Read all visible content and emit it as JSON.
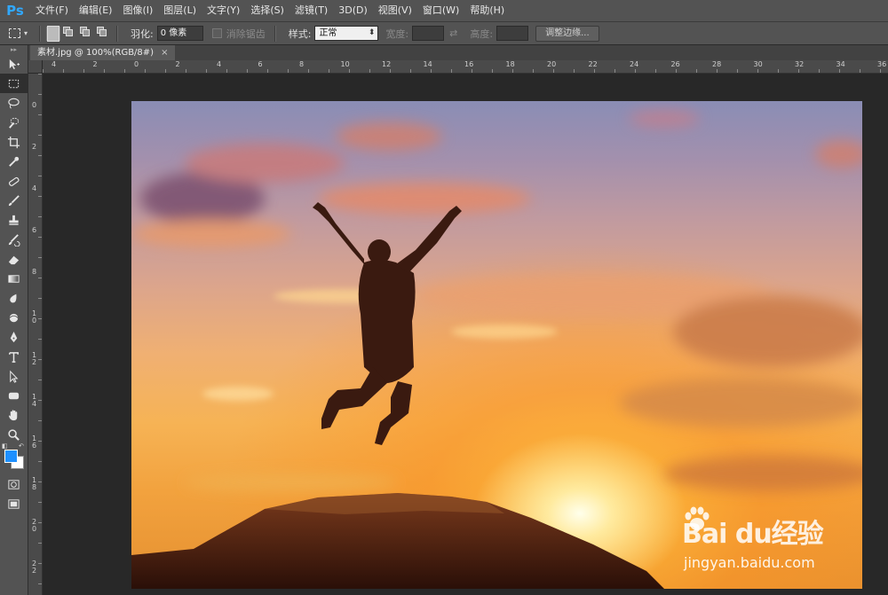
{
  "app": {
    "logo": "Ps"
  },
  "menu": [
    "文件(F)",
    "编辑(E)",
    "图像(I)",
    "图层(L)",
    "文字(Y)",
    "选择(S)",
    "滤镜(T)",
    "3D(D)",
    "视图(V)",
    "窗口(W)",
    "帮助(H)"
  ],
  "options": {
    "feather_label": "羽化:",
    "feather_value": "0 像素",
    "antialias_label": "消除锯齿",
    "style_label": "样式:",
    "style_value": "正常",
    "width_label": "宽度:",
    "height_label": "高度:",
    "refine_button": "调整边缘..."
  },
  "document": {
    "tab_title": "素材.jpg @ 100%(RGB/8#)",
    "close": "×"
  },
  "rulers": {
    "h": [
      "4",
      "2",
      "0",
      "2",
      "4",
      "6",
      "8",
      "10",
      "12",
      "14",
      "16",
      "18",
      "20",
      "22",
      "24",
      "26",
      "28",
      "30",
      "32",
      "34",
      "36"
    ],
    "v": [
      "0",
      "2",
      "4",
      "6",
      "8",
      "10",
      "12",
      "14",
      "16",
      "18",
      "20",
      "22"
    ]
  },
  "watermark": {
    "brand": "Bai du经验",
    "url": "jingyan.baidu.com"
  },
  "colors": {
    "foreground": "#1e90ff",
    "background": "#ffffff",
    "accent": "#31a8ff"
  }
}
